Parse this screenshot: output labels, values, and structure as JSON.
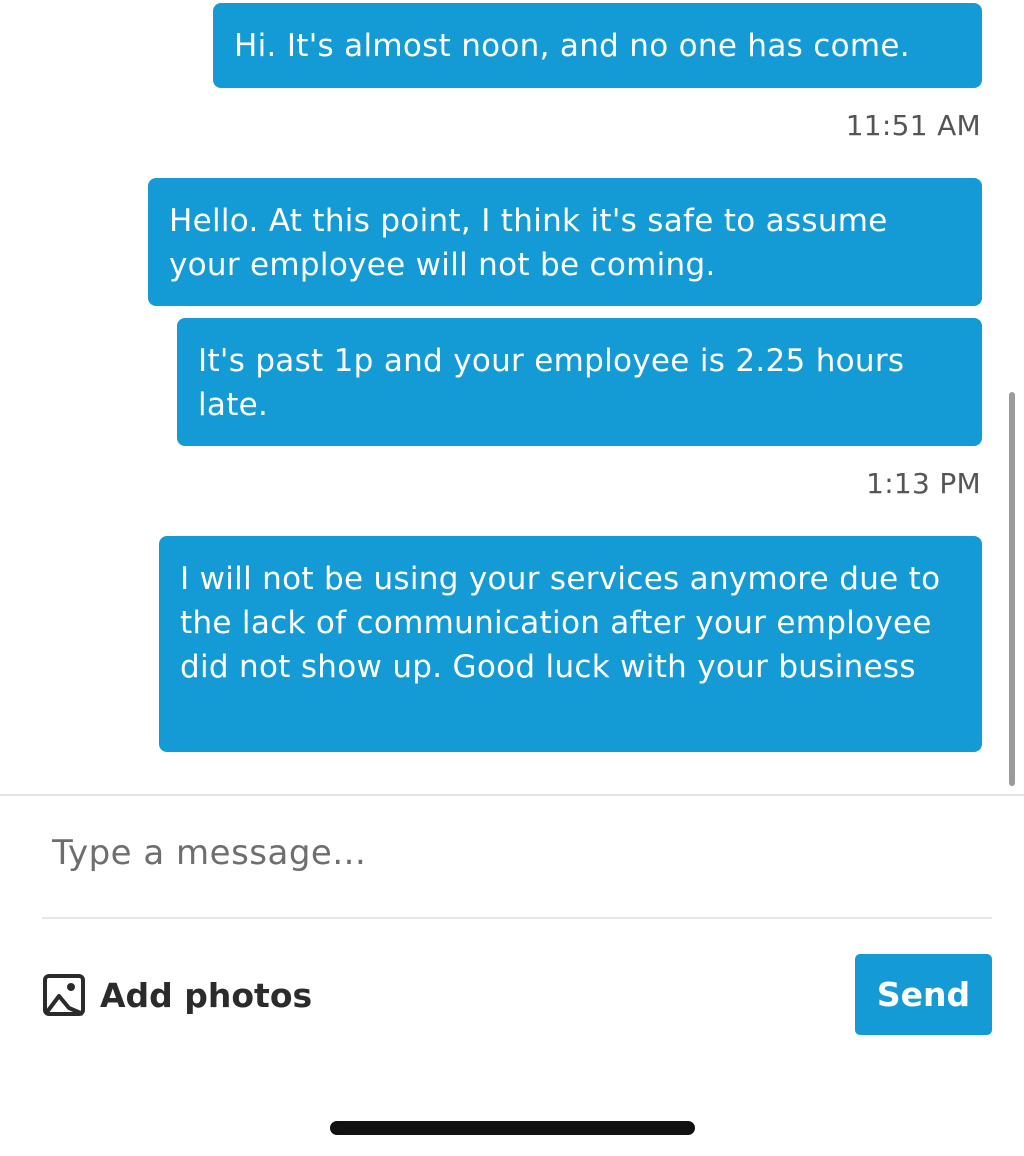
{
  "thread": {
    "messages": [
      {
        "text": "Hi. It's almost noon, and no one has come."
      },
      {
        "text": "Hello. At this point, I think it's safe to assume your employee will not be coming."
      },
      {
        "text": "It's past 1p and your employee is 2.25 hours late."
      },
      {
        "text": "I will not be using your services anymore due to the lack of communication after your employee did not show up. Good luck with your business"
      }
    ],
    "timestamps": [
      "11:51 AM",
      "1:13 PM"
    ]
  },
  "composer": {
    "placeholder": "Type a message...",
    "value": "",
    "add_photos_label": "Add photos",
    "add_photos_icon": "image-icon",
    "send_label": "Send"
  },
  "colors": {
    "accent": "#149bd6",
    "bubble_text": "#ffffff",
    "timestamp": "#555555"
  }
}
